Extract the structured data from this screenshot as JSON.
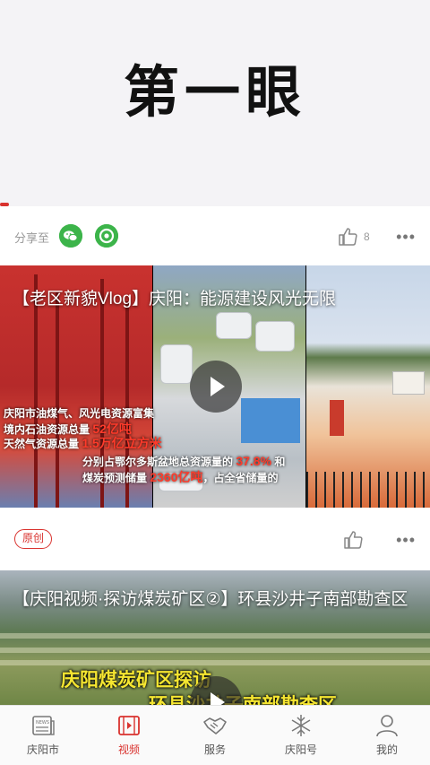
{
  "header": {
    "title": "第一眼"
  },
  "share": {
    "label": "分享至",
    "like_count": "8",
    "more": "•••",
    "wechat_icon": "wechat-icon",
    "moments_icon": "moments-icon"
  },
  "video1": {
    "title": "【老区新貌Vlog】庆阳：能源建设风光无限",
    "caption_left": [
      "庆阳市油煤气、风光电资源富集",
      "境内石油资源总量 52亿吨",
      "天然气资源总量 1.5万亿立方米"
    ],
    "caption_mid": [
      "分别占鄂尔多斯盆地总资源量的 37.8% 和",
      "煤炭预测储量 2360亿吨，占全省储量的"
    ]
  },
  "card2": {
    "badge": "原创",
    "more": "•••"
  },
  "video2": {
    "title": "【庆阳视频·探访煤炭矿区②】环县沙井子南部勘查区",
    "overlay_line1": "庆阳煤炭矿区探访",
    "overlay_line2": "环县沙井子南部勘查区"
  },
  "tabs": [
    {
      "label": "庆阳市",
      "icon": "news-icon"
    },
    {
      "label": "视频",
      "icon": "video-icon",
      "active": true
    },
    {
      "label": "服务",
      "icon": "handshake-icon"
    },
    {
      "label": "庆阳号",
      "icon": "snowflake-icon"
    },
    {
      "label": "我的",
      "icon": "profile-icon"
    }
  ],
  "colors": {
    "accent": "#d9322e",
    "wechat": "#3cb44a",
    "overlay_yellow": "#f5e631"
  }
}
